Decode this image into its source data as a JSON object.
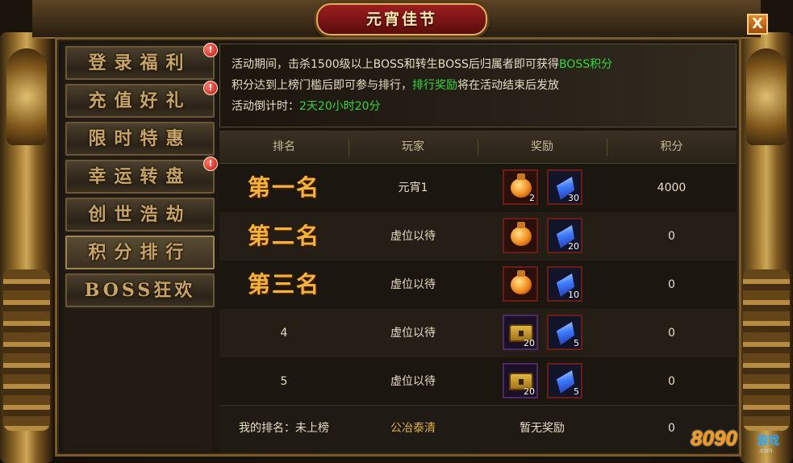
{
  "window": {
    "title": "元宵佳节",
    "close_label": "X"
  },
  "sidebar": {
    "items": [
      {
        "label": "登录福利",
        "badge": "!"
      },
      {
        "label": "充值好礼",
        "badge": "!"
      },
      {
        "label": "限时特惠",
        "badge": ""
      },
      {
        "label": "幸运转盘",
        "badge": "!"
      },
      {
        "label": "创世浩劫",
        "badge": ""
      },
      {
        "label": "积分排行",
        "badge": "",
        "active": true
      },
      {
        "label": "BOSS狂欢",
        "badge": ""
      }
    ]
  },
  "info": {
    "line1_prefix": "活动期间，击杀1500级以上BOSS和转生BOSS后归属者即可获得",
    "line1_highlight": "BOSS积分",
    "line2_prefix": "积分达到上榜门槛后即可参与排行，",
    "line2_highlight": "排行奖励",
    "line2_suffix": "将在活动结束后发放",
    "line3_prefix": "活动倒计时：",
    "line3_highlight": "2天20小时20分",
    "highlight_color": "#36d63a"
  },
  "table": {
    "headers": [
      "排名",
      "玩家",
      "奖励",
      "积分"
    ],
    "rows": [
      {
        "rank": "第一名",
        "player": "元宵1",
        "reward1": {
          "icon": "orange-potion-icon",
          "qty": "2"
        },
        "reward2": {
          "icon": "blue-crystal-icon",
          "qty": "30"
        },
        "score": "4000"
      },
      {
        "rank": "第二名",
        "player": "虚位以待",
        "reward1": {
          "icon": "orange-potion-icon",
          "qty": ""
        },
        "reward2": {
          "icon": "blue-crystal-icon",
          "qty": "20"
        },
        "score": "0"
      },
      {
        "rank": "第三名",
        "player": "虚位以待",
        "reward1": {
          "icon": "orange-potion-icon",
          "qty": ""
        },
        "reward2": {
          "icon": "blue-crystal-icon",
          "qty": "10"
        },
        "score": "0"
      },
      {
        "rank": "4",
        "player": "虚位以待",
        "reward1": {
          "icon": "treasure-chest-icon",
          "qty": "20"
        },
        "reward2": {
          "icon": "blue-crystal-icon",
          "qty": "5"
        },
        "score": "0"
      },
      {
        "rank": "5",
        "player": "虚位以待",
        "reward1": {
          "icon": "treasure-chest-icon",
          "qty": "20"
        },
        "reward2": {
          "icon": "blue-crystal-icon",
          "qty": "5"
        },
        "score": "0"
      }
    ],
    "footer": {
      "my_rank": "我的排名：未上榜",
      "player": "公冶泰清",
      "reward": "暂无奖励",
      "score": "0"
    }
  },
  "logo": {
    "number": "8090",
    "text": "游戏",
    "sub": ".com"
  }
}
